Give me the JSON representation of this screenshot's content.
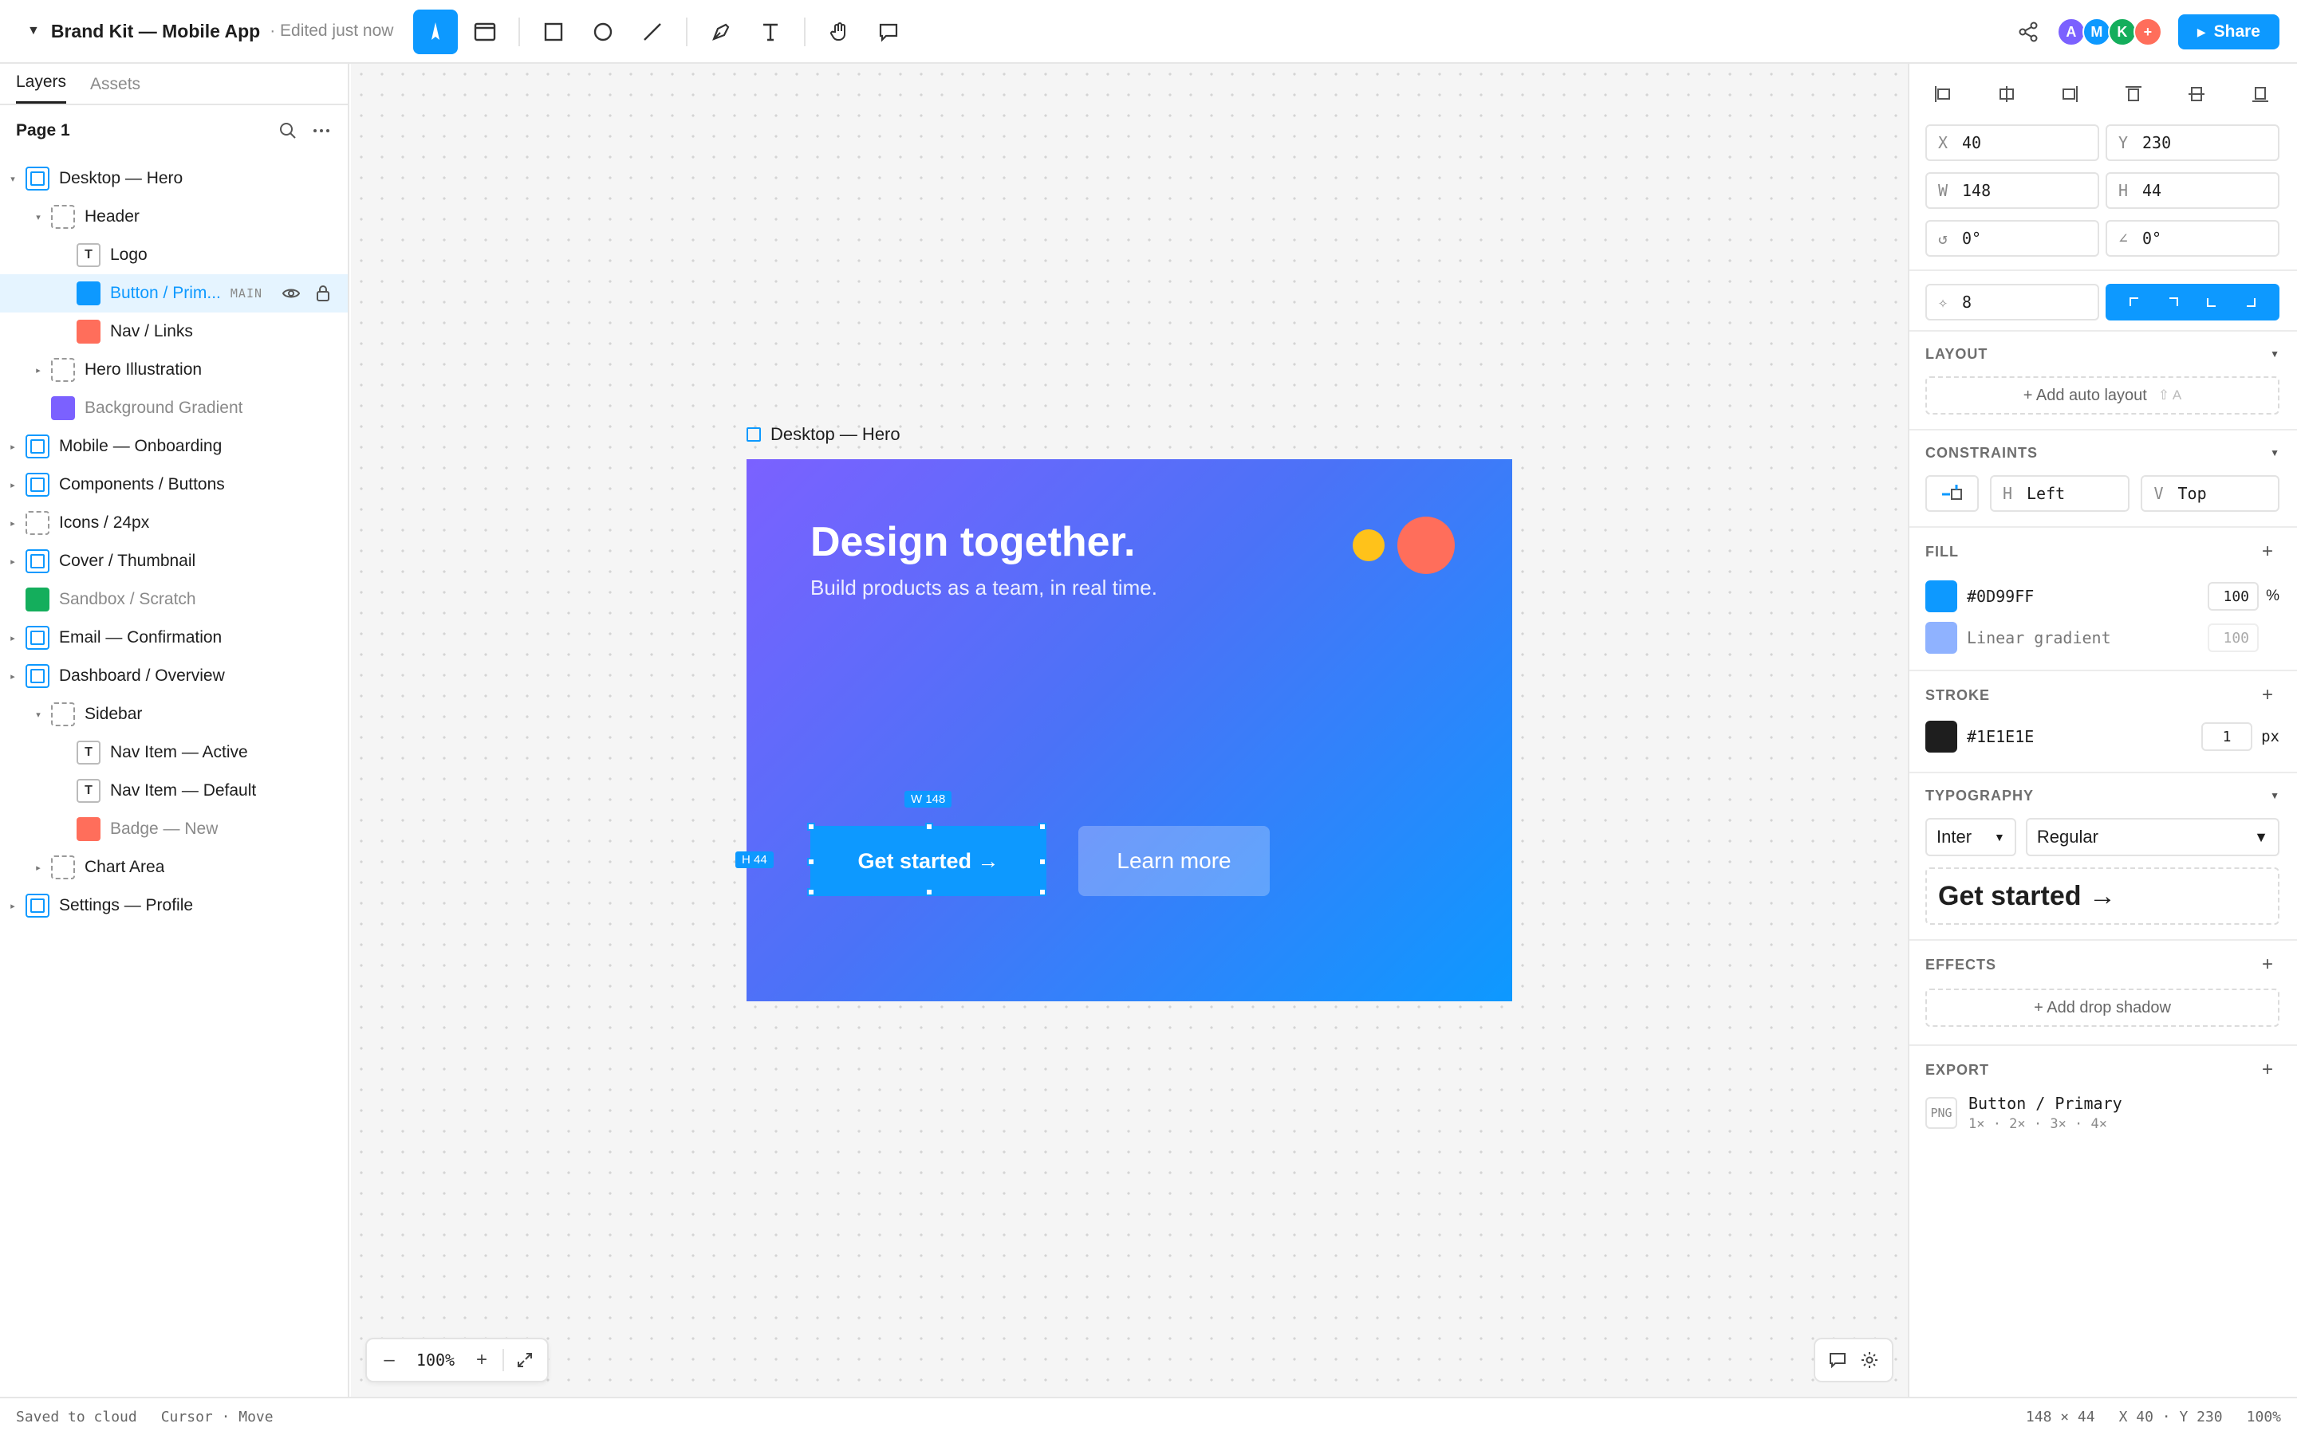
{
  "header": {
    "file_name": "Brand Kit — Mobile App",
    "file_status": "· Edited just now",
    "share_label": "Share",
    "avatars": [
      {
        "initial": "A",
        "color": "#7b61ff"
      },
      {
        "initial": "M",
        "color": "#0d99ff"
      },
      {
        "initial": "K",
        "color": "#14ae5c"
      },
      {
        "initial": "+",
        "color": "#ff6e5b"
      }
    ]
  },
  "tools": [
    "move-tool",
    "frame-tool",
    "rectangle-tool",
    "ellipse-tool",
    "line-tool",
    "pen-tool",
    "text-tool",
    "hand-tool",
    "comment-tool"
  ],
  "left_panel": {
    "tabs": [
      "Layers",
      "Assets"
    ],
    "page_name": "Page 1",
    "layers": [
      {
        "name": "Desktop — Hero",
        "kind": "frame",
        "indent": 0,
        "caret": "▾"
      },
      {
        "name": "Header",
        "kind": "group",
        "indent": 1,
        "caret": "▾"
      },
      {
        "name": "Logo",
        "kind": "text",
        "indent": 2,
        "caret": ""
      },
      {
        "name": "Button / Prim...",
        "kind": "fill",
        "color": "#0d99ff",
        "indent": 2,
        "caret": "",
        "badge": "MAIN",
        "selected": true
      },
      {
        "name": "Nav / Links",
        "kind": "fill",
        "color": "#ff6e5b",
        "indent": 2,
        "caret": ""
      },
      {
        "name": "Hero Illustration",
        "kind": "group",
        "indent": 1,
        "caret": "▸"
      },
      {
        "name": "Background Gradient",
        "kind": "fill",
        "color": "#7b61ff",
        "indent": 1,
        "caret": "",
        "muted": true
      },
      {
        "name": "Mobile — Onboarding",
        "kind": "frame",
        "indent": 0,
        "caret": "▸"
      },
      {
        "name": "Components / Buttons",
        "kind": "frame",
        "indent": 0,
        "caret": "▸"
      },
      {
        "name": "Icons / 24px",
        "kind": "group",
        "indent": 0,
        "caret": "▸"
      },
      {
        "name": "Cover / Thumbnail",
        "kind": "frame",
        "indent": 0,
        "caret": "▸"
      },
      {
        "name": "Sandbox / Scratch",
        "kind": "fill",
        "color": "#14ae5c",
        "indent": 0,
        "caret": "",
        "muted": true
      },
      {
        "name": "Email — Confirmation",
        "kind": "frame",
        "indent": 0,
        "caret": "▸"
      },
      {
        "name": "Dashboard / Overview",
        "kind": "frame",
        "indent": 0,
        "caret": "▸"
      },
      {
        "name": "Sidebar",
        "kind": "group",
        "indent": 1,
        "caret": "▾"
      },
      {
        "name": "Nav Item — Active",
        "kind": "text",
        "indent": 2,
        "caret": ""
      },
      {
        "name": "Nav Item — Default",
        "kind": "text",
        "indent": 2,
        "caret": ""
      },
      {
        "name": "Badge — New",
        "kind": "fill",
        "color": "#ff6e5b",
        "indent": 2,
        "caret": "",
        "muted": true
      },
      {
        "name": "Chart Area",
        "kind": "group",
        "indent": 1,
        "caret": "▸"
      },
      {
        "name": "Settings — Profile",
        "kind": "frame",
        "indent": 0,
        "caret": "▸"
      }
    ]
  },
  "canvas": {
    "frame_label": "Desktop — Hero",
    "hero_title": "Design together.",
    "hero_subtitle": "Build products as a team, in real time.",
    "primary_button": "Get started →",
    "secondary_button": "Learn more",
    "width_tag": "W 148",
    "height_tag": "H 44",
    "zoom": "100%"
  },
  "right_panel": {
    "x": "40",
    "y": "230",
    "w": "148",
    "h": "44",
    "rotation": "0°",
    "skew": "0°",
    "radius": "8",
    "layout_title": "LAYOUT",
    "auto_layout": "+ Add auto layout",
    "auto_layout_shortcut": "⇧ A",
    "constraints_title": "CONSTRAINTS",
    "constraint_h": "Left",
    "constraint_v": "Top",
    "fill_title": "FILL",
    "fills": [
      {
        "hex": "#0D99FF",
        "opacity": "100",
        "swatch": "#0d99ff"
      },
      {
        "hex": "Linear gradient",
        "opacity": "100",
        "swatch": "#8fb2ff"
      }
    ],
    "fill_unit": "%",
    "stroke_title": "STROKE",
    "stroke_hex": "#1E1E1E",
    "stroke_width": "1",
    "stroke_unit": "px",
    "typography_title": "TYPOGRAPHY",
    "font_family": "Inter",
    "font_weight": "Regular",
    "typo_preview": "Get started →",
    "effects_title": "EFFECTS",
    "add_shadow": "+ Add drop shadow",
    "export_title": "EXPORT",
    "export_format": "PNG",
    "export_name": "Button / Primary",
    "export_scales": "1× · 2× · 3× · 4×"
  },
  "status": {
    "saved": "Saved to cloud",
    "cursor": "Cursor · Move",
    "size": "148 × 44",
    "pos": "X 40 · Y 230",
    "zoom": "100%"
  }
}
